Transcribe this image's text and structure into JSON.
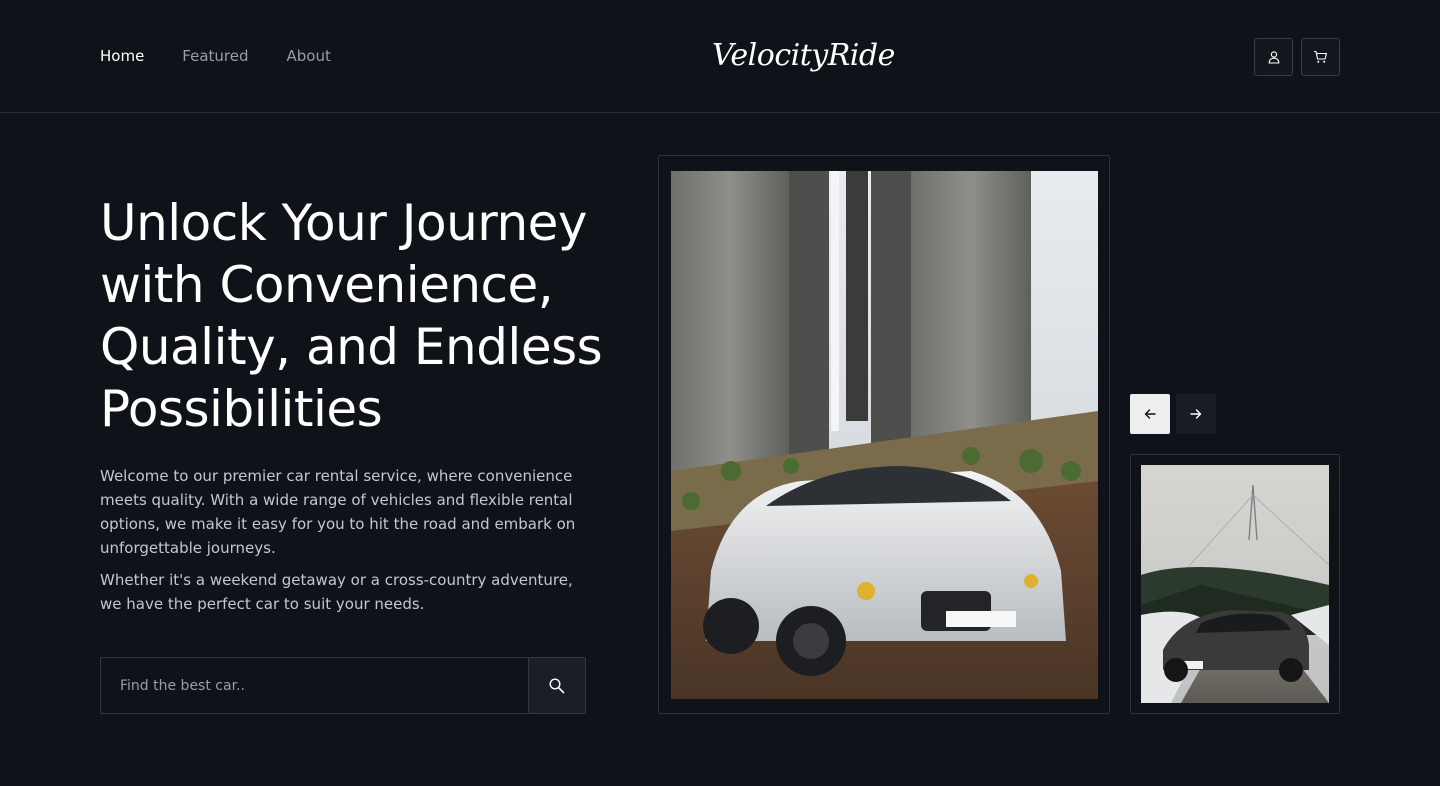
{
  "nav": {
    "items": [
      {
        "label": "Home",
        "active": true
      },
      {
        "label": "Featured",
        "active": false
      },
      {
        "label": "About",
        "active": false
      }
    ]
  },
  "brand": {
    "logo": "VelocityRide"
  },
  "header_icons": {
    "account": "user-icon",
    "cart": "cart-icon"
  },
  "hero": {
    "title": "Unlock Your Journey with Convenience, Quality, and Endless Possibilities",
    "paragraph1": "Welcome to our premier car rental service, where convenience meets quality. With a wide range of vehicles and flexible rental options, we make it easy for you to hit the road and embark on unforgettable journeys.",
    "paragraph2": " Whether it's a weekend getaway or a cross-country adventure, we have the perfect car to suit your needs."
  },
  "search": {
    "placeholder": "Find the best car..",
    "value": "",
    "icon": "search-icon"
  },
  "carousel": {
    "main_image": "white-coupe-under-bridge",
    "side_image": "black-sports-car-road",
    "prev_icon": "arrow-left-icon",
    "next_icon": "arrow-right-icon"
  },
  "colors": {
    "background": "#10121a",
    "text": "#ffffff",
    "muted": "#9a9ca6",
    "border": "#2f323a",
    "prev_button": "#eeeeee"
  }
}
